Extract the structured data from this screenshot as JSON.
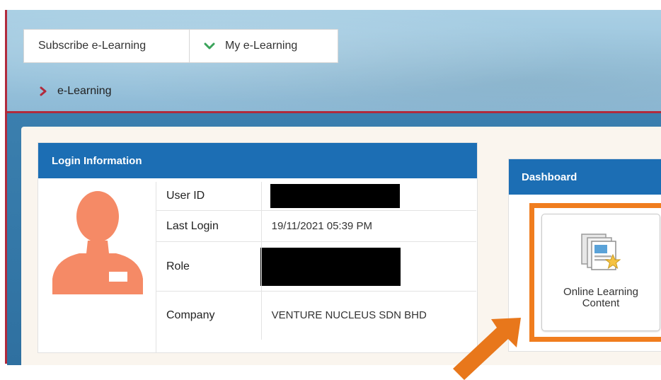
{
  "nav": {
    "tabs": [
      {
        "label": "Subscribe e-Learning"
      },
      {
        "label": "My e-Learning",
        "icon": "chevron-down-icon"
      }
    ],
    "breadcrumb": {
      "label": "e-Learning",
      "icon": "chevron-right-icon"
    }
  },
  "login_info": {
    "title": "Login Information",
    "avatar_icon": "user-avatar-icon",
    "rows": [
      {
        "label": "User ID",
        "value": ""
      },
      {
        "label": "Last Login",
        "value": "19/11/2021 05:39 PM"
      },
      {
        "label": "Role",
        "value": ""
      },
      {
        "label": "Company",
        "value": "VENTURE NUCLEUS SDN BHD"
      }
    ]
  },
  "dashboard": {
    "title": "Dashboard",
    "tiles": [
      {
        "label": "Online Learning Content",
        "icon": "documents-star-icon"
      }
    ]
  },
  "annotation": {
    "icon": "arrow-icon"
  },
  "colors": {
    "brand_red": "#b12a3c",
    "header_blue": "#1c6eb4",
    "highlight_orange": "#f07d1e",
    "avatar_orange": "#f58a66",
    "chevron_green": "#3aa35a"
  }
}
